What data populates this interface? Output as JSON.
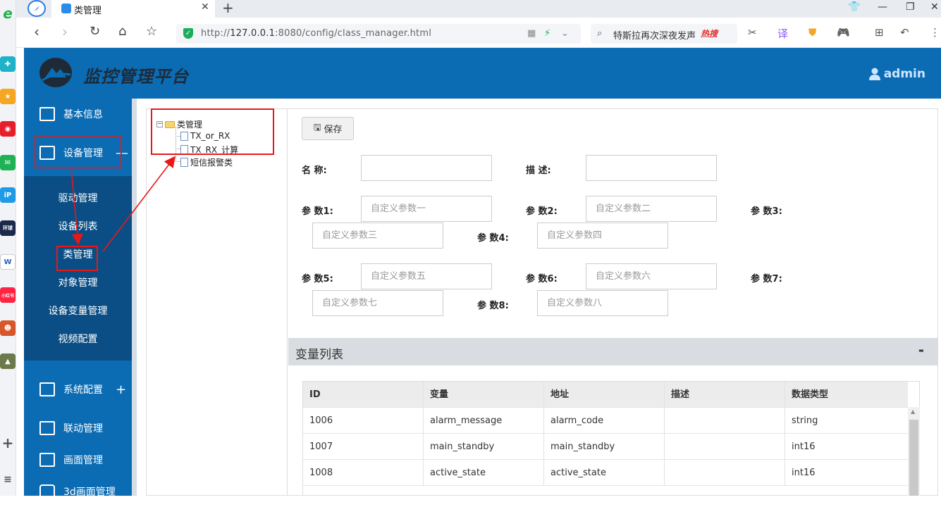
{
  "browser": {
    "tab_title": "类管理",
    "address_host": "127.0.0.1",
    "address_prefix": "http://",
    "address_rest": ":8080/config/class_manager.html",
    "search_text": "特斯拉再次深夜发声",
    "search_badge": "热搜",
    "left_dock_labels": [
      "e",
      "",
      "",
      "",
      "",
      "iP",
      "环球网校",
      "W",
      "小红书",
      "",
      ""
    ]
  },
  "header": {
    "title": "监控管理平台",
    "user": "admin"
  },
  "sidebar": {
    "items": [
      {
        "label": "基本信息",
        "icon": "clipboard-icon"
      },
      {
        "label": "设备管理",
        "icon": "monitor-icon",
        "toggle": "—"
      },
      {
        "label": "系统配置",
        "icon": "sliders-icon",
        "toggle": "+"
      },
      {
        "label": "联动管理",
        "icon": "link-doc-icon"
      },
      {
        "label": "画面管理",
        "icon": "image-icon"
      },
      {
        "label": "3d画面管理",
        "icon": "3d-icon"
      }
    ],
    "sub_items": [
      "驱动管理",
      "设备列表",
      "类管理",
      "对象管理",
      "设备变量管理",
      "视频配置"
    ]
  },
  "tree": {
    "root": "类管理",
    "children": [
      "TX_or_RX",
      "TX_RX_计算",
      "短信报警类"
    ]
  },
  "form": {
    "save_label": "保存",
    "name_label": "名 称:",
    "desc_label": "描 述:",
    "params": [
      {
        "label": "参 数1:",
        "placeholder": "自定义参数一"
      },
      {
        "label": "参 数2:",
        "placeholder": "自定义参数二"
      },
      {
        "label": "参 数3:",
        "placeholder": "自定义参数三"
      },
      {
        "label": "参 数4:",
        "placeholder": "自定义参数四"
      },
      {
        "label": "参 数5:",
        "placeholder": "自定义参数五"
      },
      {
        "label": "参 数6:",
        "placeholder": "自定义参数六"
      },
      {
        "label": "参 数7:",
        "placeholder": "自定义参数七"
      },
      {
        "label": "参 数8:",
        "placeholder": "自定义参数八"
      }
    ]
  },
  "variables": {
    "title": "变量列表",
    "collapse": "-",
    "columns": [
      "ID",
      "变量",
      "地址",
      "描述",
      "数据类型"
    ],
    "rows": [
      [
        "1006",
        "alarm_message",
        "alarm_code",
        "",
        "string"
      ],
      [
        "1007",
        "main_standby",
        "main_standby",
        "",
        "int16"
      ],
      [
        "1008",
        "active_state",
        "active_state",
        "",
        "int16"
      ]
    ]
  },
  "colors": {
    "brand_blue": "#0b6cb4",
    "submenu_blue": "#0a4e85",
    "annotation_red": "#e81818"
  }
}
